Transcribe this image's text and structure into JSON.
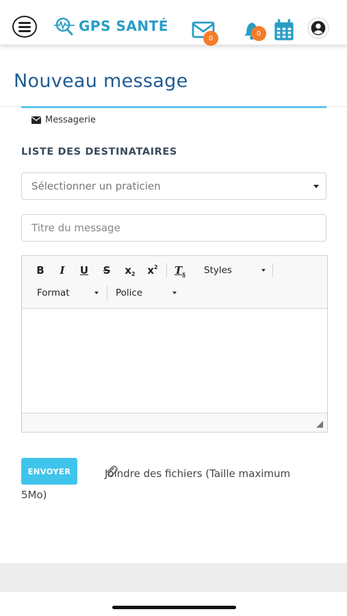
{
  "header": {
    "logo_text": "GPS SANTÉ",
    "mail_count": "0",
    "notification_count": "0",
    "accent_color": "#2a9dc6",
    "badge_color": "#f57c2b",
    "icons": [
      "menu-icon",
      "gps-sante-logo-icon",
      "envelope-icon",
      "bell-icon",
      "calendar-icon",
      "user-circle-icon"
    ]
  },
  "page": {
    "title": "Nouveau message",
    "breadcrumb_label": "Messagerie"
  },
  "form": {
    "section_title": "LISTE DES DESTINATAIRES",
    "recipient_placeholder": "Sélectionner un praticien",
    "title_placeholder": "Titre du message",
    "send_label": "ENVOYER",
    "attach_label": "Joindre des fichiers (Taille maximum 5Mo)"
  },
  "editor": {
    "buttons": {
      "bold": "B",
      "italic": "I",
      "underline": "U",
      "strike": "S",
      "subscript": "x",
      "superscript": "x",
      "remove_format": "T"
    },
    "styles_label": "Styles",
    "format_label": "Format",
    "font_label": "Police"
  }
}
